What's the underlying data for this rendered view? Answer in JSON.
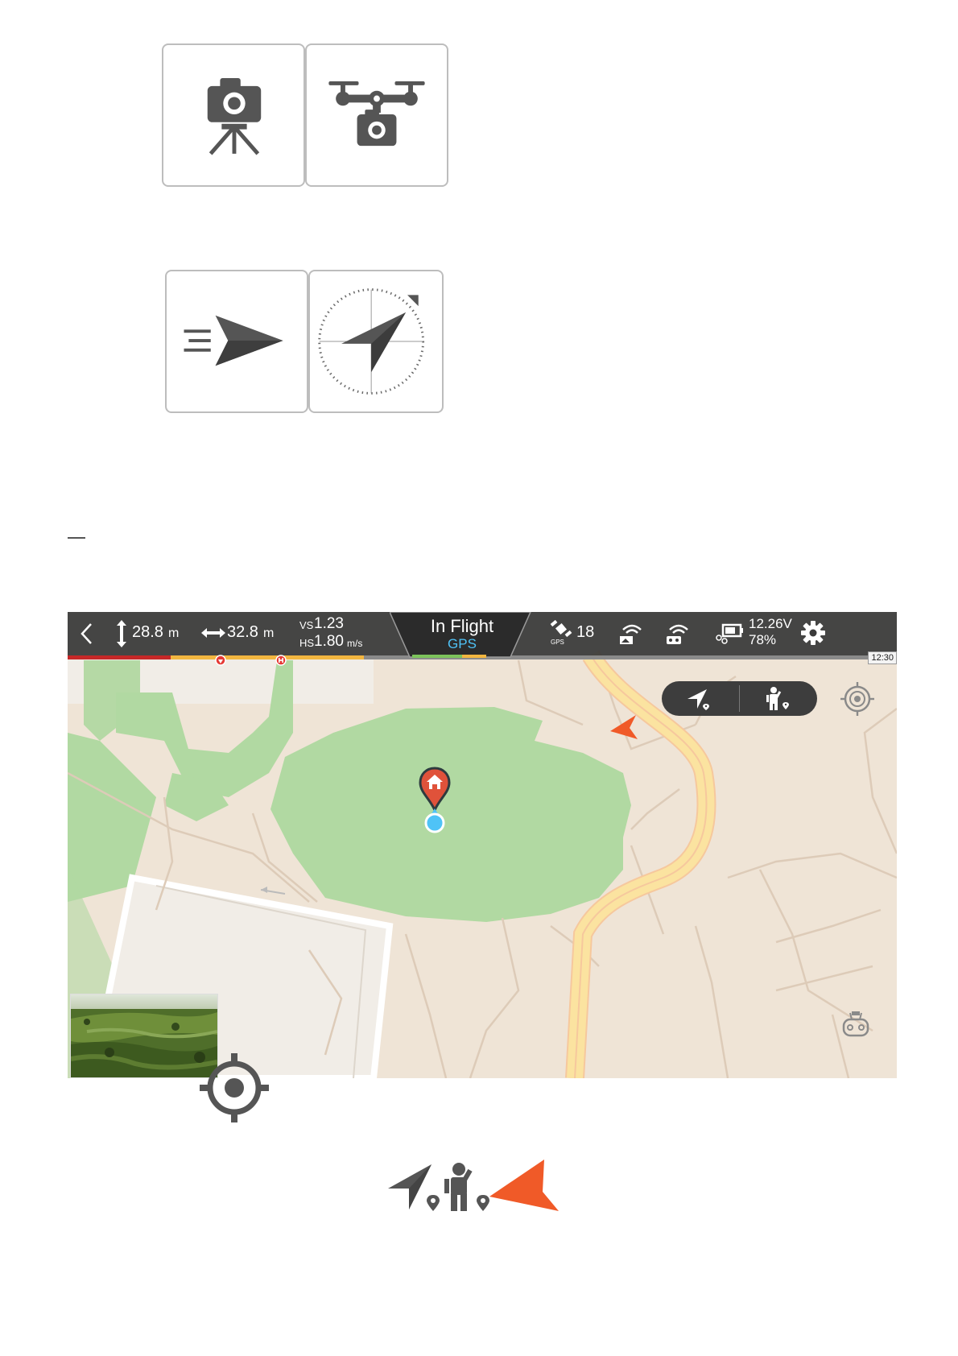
{
  "icons_row1": [
    "tripod-camera-icon",
    "drone-camera-icon"
  ],
  "icons_row2": [
    "paper-plane-speed-icon",
    "compass-plane-icon"
  ],
  "topbar": {
    "altitude_value": "28.8",
    "altitude_unit": "m",
    "distance_value": "32.8",
    "distance_unit": "m",
    "vs_label": "VS",
    "vs_value": "1.23",
    "hs_label": "HS",
    "hs_value": "1.80",
    "speed_unit": "m/s",
    "flight_state": "In Flight",
    "flight_mode": "GPS",
    "gps_satellites": "18",
    "gps_label": "GPS",
    "voltage": "12.26V",
    "battery_percent": "78%",
    "time": "12:30"
  },
  "colors": {
    "topbar_bg": "#3a3a3a",
    "gps_accent": "#4fc3f7",
    "home_marker": "#e0523a",
    "drone_arrow": "#f05a28",
    "park_green": "#b1d9a2",
    "road_yellow": "#fbe3a0"
  },
  "map_markers": [
    "home-marker",
    "aircraft-position",
    "drone-arrow"
  ],
  "bottom_icons": [
    "locate-icon",
    "aircraft-location-icon",
    "pilot-location-icon",
    "drone-arrow-icon"
  ]
}
